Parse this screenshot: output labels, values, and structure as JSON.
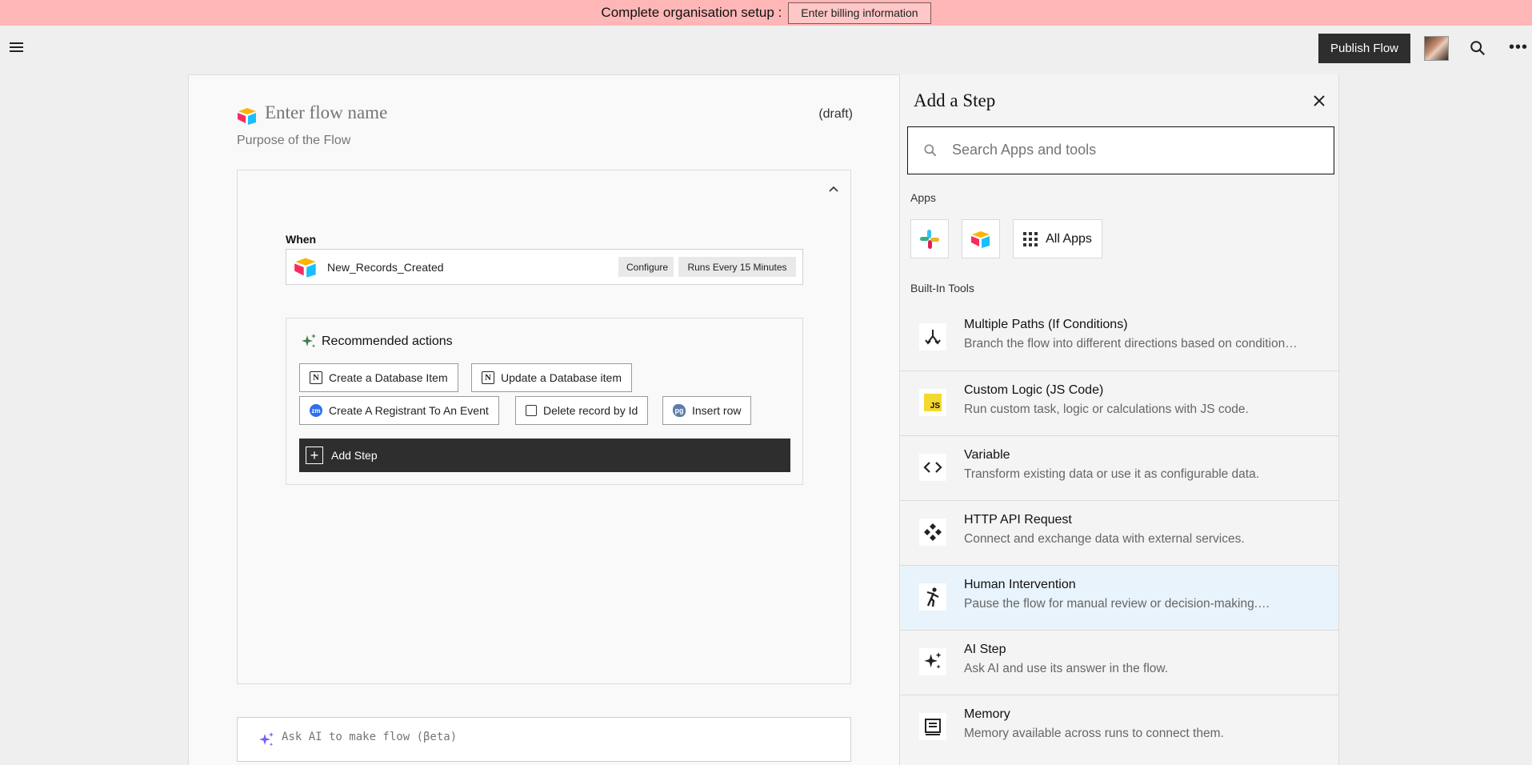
{
  "banner": {
    "text": "Complete organisation setup :",
    "button_label": "Enter billing information"
  },
  "topbar": {
    "publish_label": "Publish Flow"
  },
  "flow": {
    "name_placeholder": "Enter flow name",
    "status": "(draft)",
    "purpose_placeholder": "Purpose of the Flow",
    "when_label": "When",
    "trigger": {
      "name": "New_Records_Created",
      "configure_label": "Configure",
      "schedule_label": "Runs Every 15 Minutes"
    },
    "recommended": {
      "title": "Recommended actions",
      "actions": [
        {
          "label": "Create a Database Item",
          "icon": "notion-icon"
        },
        {
          "label": "Update a Database item",
          "icon": "notion-icon"
        },
        {
          "label": "Create A Registrant To An Event",
          "icon": "zoom-icon"
        },
        {
          "label": "Delete record by Id",
          "icon": "delete-record-icon"
        },
        {
          "label": "Insert row",
          "icon": "postgres-icon"
        }
      ]
    },
    "add_step_label": "Add Step",
    "ai_placeholder": "Ask AI to make flow (βeta)"
  },
  "panel": {
    "title": "Add a Step",
    "search_placeholder": "Search Apps and tools",
    "apps_label": "Apps",
    "all_apps_label": "All Apps",
    "builtin_label": "Built-In Tools",
    "tools": [
      {
        "name": "Multiple Paths (If Conditions)",
        "desc": "Branch the flow into different directions based on condition…",
        "icon": "branch-icon"
      },
      {
        "name": "Custom Logic (JS Code)",
        "desc": "Run custom task, logic or calculations with JS code.",
        "icon": "js-icon"
      },
      {
        "name": "Variable",
        "desc": "Transform existing data or use it as configurable data.",
        "icon": "code-brackets-icon"
      },
      {
        "name": "HTTP API Request",
        "desc": "Connect and exchange data with external services.",
        "icon": "api-icon"
      },
      {
        "name": "Human Intervention",
        "desc": "Pause the flow for manual review or decision-making.…",
        "icon": "human-icon"
      },
      {
        "name": "AI Step",
        "desc": "Ask AI and use its answer in the flow.",
        "icon": "sparkle-icon"
      },
      {
        "name": "Memory",
        "desc": "Memory available across runs to connect them.",
        "icon": "memory-icon"
      }
    ]
  },
  "colors": {
    "banner_bg": "#ffb6b6",
    "primary_dark": "#2e2e2e",
    "highlight_row": "#e8f3fb"
  }
}
